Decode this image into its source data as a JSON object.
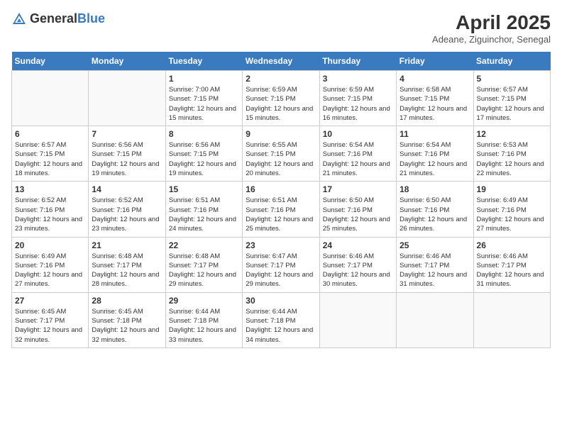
{
  "logo": {
    "text_general": "General",
    "text_blue": "Blue"
  },
  "title": "April 2025",
  "location": "Adeane, Ziguinchor, Senegal",
  "days_of_week": [
    "Sunday",
    "Monday",
    "Tuesday",
    "Wednesday",
    "Thursday",
    "Friday",
    "Saturday"
  ],
  "weeks": [
    [
      {
        "day": "",
        "info": ""
      },
      {
        "day": "",
        "info": ""
      },
      {
        "day": "1",
        "info": "Sunrise: 7:00 AM\nSunset: 7:15 PM\nDaylight: 12 hours and 15 minutes."
      },
      {
        "day": "2",
        "info": "Sunrise: 6:59 AM\nSunset: 7:15 PM\nDaylight: 12 hours and 15 minutes."
      },
      {
        "day": "3",
        "info": "Sunrise: 6:59 AM\nSunset: 7:15 PM\nDaylight: 12 hours and 16 minutes."
      },
      {
        "day": "4",
        "info": "Sunrise: 6:58 AM\nSunset: 7:15 PM\nDaylight: 12 hours and 17 minutes."
      },
      {
        "day": "5",
        "info": "Sunrise: 6:57 AM\nSunset: 7:15 PM\nDaylight: 12 hours and 17 minutes."
      }
    ],
    [
      {
        "day": "6",
        "info": "Sunrise: 6:57 AM\nSunset: 7:15 PM\nDaylight: 12 hours and 18 minutes."
      },
      {
        "day": "7",
        "info": "Sunrise: 6:56 AM\nSunset: 7:15 PM\nDaylight: 12 hours and 19 minutes."
      },
      {
        "day": "8",
        "info": "Sunrise: 6:56 AM\nSunset: 7:15 PM\nDaylight: 12 hours and 19 minutes."
      },
      {
        "day": "9",
        "info": "Sunrise: 6:55 AM\nSunset: 7:15 PM\nDaylight: 12 hours and 20 minutes."
      },
      {
        "day": "10",
        "info": "Sunrise: 6:54 AM\nSunset: 7:16 PM\nDaylight: 12 hours and 21 minutes."
      },
      {
        "day": "11",
        "info": "Sunrise: 6:54 AM\nSunset: 7:16 PM\nDaylight: 12 hours and 21 minutes."
      },
      {
        "day": "12",
        "info": "Sunrise: 6:53 AM\nSunset: 7:16 PM\nDaylight: 12 hours and 22 minutes."
      }
    ],
    [
      {
        "day": "13",
        "info": "Sunrise: 6:52 AM\nSunset: 7:16 PM\nDaylight: 12 hours and 23 minutes."
      },
      {
        "day": "14",
        "info": "Sunrise: 6:52 AM\nSunset: 7:16 PM\nDaylight: 12 hours and 23 minutes."
      },
      {
        "day": "15",
        "info": "Sunrise: 6:51 AM\nSunset: 7:16 PM\nDaylight: 12 hours and 24 minutes."
      },
      {
        "day": "16",
        "info": "Sunrise: 6:51 AM\nSunset: 7:16 PM\nDaylight: 12 hours and 25 minutes."
      },
      {
        "day": "17",
        "info": "Sunrise: 6:50 AM\nSunset: 7:16 PM\nDaylight: 12 hours and 25 minutes."
      },
      {
        "day": "18",
        "info": "Sunrise: 6:50 AM\nSunset: 7:16 PM\nDaylight: 12 hours and 26 minutes."
      },
      {
        "day": "19",
        "info": "Sunrise: 6:49 AM\nSunset: 7:16 PM\nDaylight: 12 hours and 27 minutes."
      }
    ],
    [
      {
        "day": "20",
        "info": "Sunrise: 6:49 AM\nSunset: 7:16 PM\nDaylight: 12 hours and 27 minutes."
      },
      {
        "day": "21",
        "info": "Sunrise: 6:48 AM\nSunset: 7:17 PM\nDaylight: 12 hours and 28 minutes."
      },
      {
        "day": "22",
        "info": "Sunrise: 6:48 AM\nSunset: 7:17 PM\nDaylight: 12 hours and 29 minutes."
      },
      {
        "day": "23",
        "info": "Sunrise: 6:47 AM\nSunset: 7:17 PM\nDaylight: 12 hours and 29 minutes."
      },
      {
        "day": "24",
        "info": "Sunrise: 6:46 AM\nSunset: 7:17 PM\nDaylight: 12 hours and 30 minutes."
      },
      {
        "day": "25",
        "info": "Sunrise: 6:46 AM\nSunset: 7:17 PM\nDaylight: 12 hours and 31 minutes."
      },
      {
        "day": "26",
        "info": "Sunrise: 6:46 AM\nSunset: 7:17 PM\nDaylight: 12 hours and 31 minutes."
      }
    ],
    [
      {
        "day": "27",
        "info": "Sunrise: 6:45 AM\nSunset: 7:17 PM\nDaylight: 12 hours and 32 minutes."
      },
      {
        "day": "28",
        "info": "Sunrise: 6:45 AM\nSunset: 7:18 PM\nDaylight: 12 hours and 32 minutes."
      },
      {
        "day": "29",
        "info": "Sunrise: 6:44 AM\nSunset: 7:18 PM\nDaylight: 12 hours and 33 minutes."
      },
      {
        "day": "30",
        "info": "Sunrise: 6:44 AM\nSunset: 7:18 PM\nDaylight: 12 hours and 34 minutes."
      },
      {
        "day": "",
        "info": ""
      },
      {
        "day": "",
        "info": ""
      },
      {
        "day": "",
        "info": ""
      }
    ]
  ]
}
